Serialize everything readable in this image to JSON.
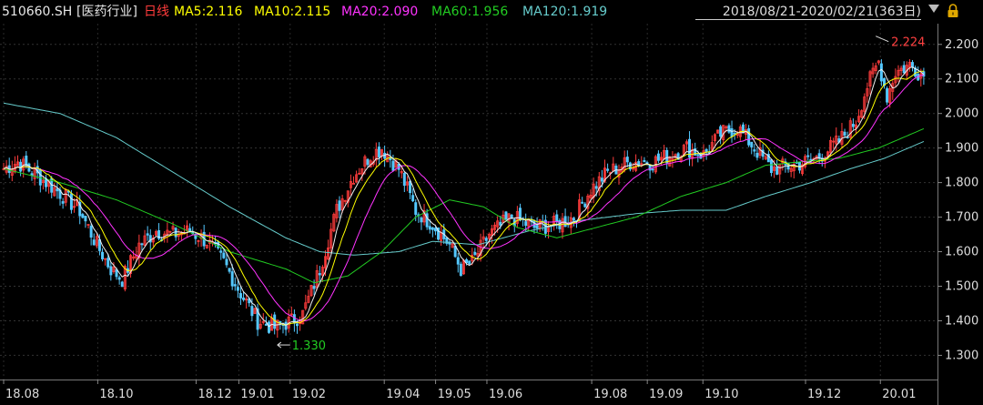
{
  "header": {
    "symbol": "510660.SH",
    "sector": "[医药行业]",
    "period": "日线",
    "ma": [
      {
        "label": "MA5:2.116",
        "color": "#ffff00"
      },
      {
        "label": "MA10:2.115",
        "color": "#ffff00"
      },
      {
        "label": "MA20:2.090",
        "color": "#ff33ff"
      },
      {
        "label": "MA60:1.956",
        "color": "#22cc22"
      },
      {
        "label": "MA120:1.919",
        "color": "#66cccc"
      }
    ],
    "range_label": "2018/08/21-2020/02/21(363日)"
  },
  "colors": {
    "up": "#ff3c3c",
    "down": "#54c8ff",
    "ma5": "#f0f0f0",
    "ma10": "#ffff00",
    "ma20": "#ff33ff",
    "ma60": "#22cc22",
    "ma120": "#66cccc",
    "low_ann": "#22cc22",
    "high_ann": "#ff4040"
  },
  "icons": [
    "dropdown-triangle-icon",
    "lock-icon"
  ],
  "chart_data": {
    "type": "candlestick",
    "title": "510660.SH [医药行业] 日线",
    "ylim": [
      1.23,
      2.26
    ],
    "yticks": [
      "2.200",
      "2.100",
      "2.000",
      "1.900",
      "1.800",
      "1.700",
      "1.600",
      "1.500",
      "1.400",
      "1.300"
    ],
    "xticks": [
      "18.08",
      "18.10",
      "18.12",
      "19.01",
      "19.02",
      "19.04",
      "19.05",
      "19.06",
      "19.08",
      "19.09",
      "19.10",
      "19.12",
      "20.01"
    ],
    "annotations": {
      "low": "1.330",
      "high": "2.224"
    },
    "price_path": [
      [
        0,
        1.84
      ],
      [
        5,
        1.86
      ],
      [
        12,
        1.82
      ],
      [
        20,
        1.77
      ],
      [
        27,
        1.72
      ],
      [
        33,
        1.62
      ],
      [
        38,
        1.55
      ],
      [
        42,
        1.52
      ],
      [
        48,
        1.62
      ],
      [
        54,
        1.66
      ],
      [
        60,
        1.65
      ],
      [
        66,
        1.66
      ],
      [
        72,
        1.63
      ],
      [
        78,
        1.57
      ],
      [
        84,
        1.48
      ],
      [
        90,
        1.4
      ],
      [
        96,
        1.38
      ],
      [
        102,
        1.4
      ],
      [
        106,
        1.42
      ],
      [
        112,
        1.55
      ],
      [
        118,
        1.72
      ],
      [
        124,
        1.82
      ],
      [
        130,
        1.88
      ],
      [
        134,
        1.9
      ],
      [
        140,
        1.84
      ],
      [
        146,
        1.72
      ],
      [
        152,
        1.68
      ],
      [
        158,
        1.62
      ],
      [
        162,
        1.55
      ],
      [
        166,
        1.57
      ],
      [
        172,
        1.65
      ],
      [
        180,
        1.7
      ],
      [
        188,
        1.67
      ],
      [
        196,
        1.68
      ],
      [
        202,
        1.7
      ],
      [
        208,
        1.78
      ],
      [
        214,
        1.83
      ],
      [
        222,
        1.86
      ],
      [
        230,
        1.86
      ],
      [
        236,
        1.88
      ],
      [
        242,
        1.9
      ],
      [
        248,
        1.88
      ],
      [
        254,
        1.94
      ],
      [
        260,
        1.96
      ],
      [
        266,
        1.9
      ],
      [
        272,
        1.84
      ],
      [
        280,
        1.85
      ],
      [
        288,
        1.87
      ],
      [
        296,
        1.92
      ],
      [
        302,
        1.98
      ],
      [
        306,
        2.08
      ],
      [
        310,
        2.15
      ],
      [
        313,
        2.05
      ],
      [
        316,
        2.12
      ],
      [
        321,
        2.14
      ],
      [
        326,
        2.11
      ]
    ],
    "ma60_path": [
      [
        0,
        1.84
      ],
      [
        20,
        1.8
      ],
      [
        40,
        1.75
      ],
      [
        60,
        1.68
      ],
      [
        80,
        1.6
      ],
      [
        100,
        1.55
      ],
      [
        110,
        1.51
      ],
      [
        122,
        1.53
      ],
      [
        134,
        1.6
      ],
      [
        146,
        1.7
      ],
      [
        158,
        1.75
      ],
      [
        170,
        1.73
      ],
      [
        182,
        1.67
      ],
      [
        196,
        1.64
      ],
      [
        210,
        1.67
      ],
      [
        224,
        1.7
      ],
      [
        240,
        1.76
      ],
      [
        256,
        1.8
      ],
      [
        270,
        1.85
      ],
      [
        282,
        1.86
      ],
      [
        296,
        1.87
      ],
      [
        310,
        1.9
      ],
      [
        326,
        1.956
      ]
    ],
    "ma120_path": [
      [
        0,
        2.03
      ],
      [
        20,
        2.0
      ],
      [
        40,
        1.93
      ],
      [
        60,
        1.83
      ],
      [
        80,
        1.73
      ],
      [
        100,
        1.64
      ],
      [
        112,
        1.6
      ],
      [
        124,
        1.59
      ],
      [
        140,
        1.6
      ],
      [
        152,
        1.63
      ],
      [
        168,
        1.62
      ],
      [
        186,
        1.66
      ],
      [
        204,
        1.69
      ],
      [
        224,
        1.71
      ],
      [
        240,
        1.72
      ],
      [
        256,
        1.72
      ],
      [
        270,
        1.76
      ],
      [
        286,
        1.8
      ],
      [
        300,
        1.84
      ],
      [
        312,
        1.87
      ],
      [
        326,
        1.919
      ]
    ],
    "latest": {
      "MA5": 2.116,
      "MA10": 2.115,
      "MA20": 2.09,
      "MA60": 1.956,
      "MA120": 1.919
    }
  }
}
